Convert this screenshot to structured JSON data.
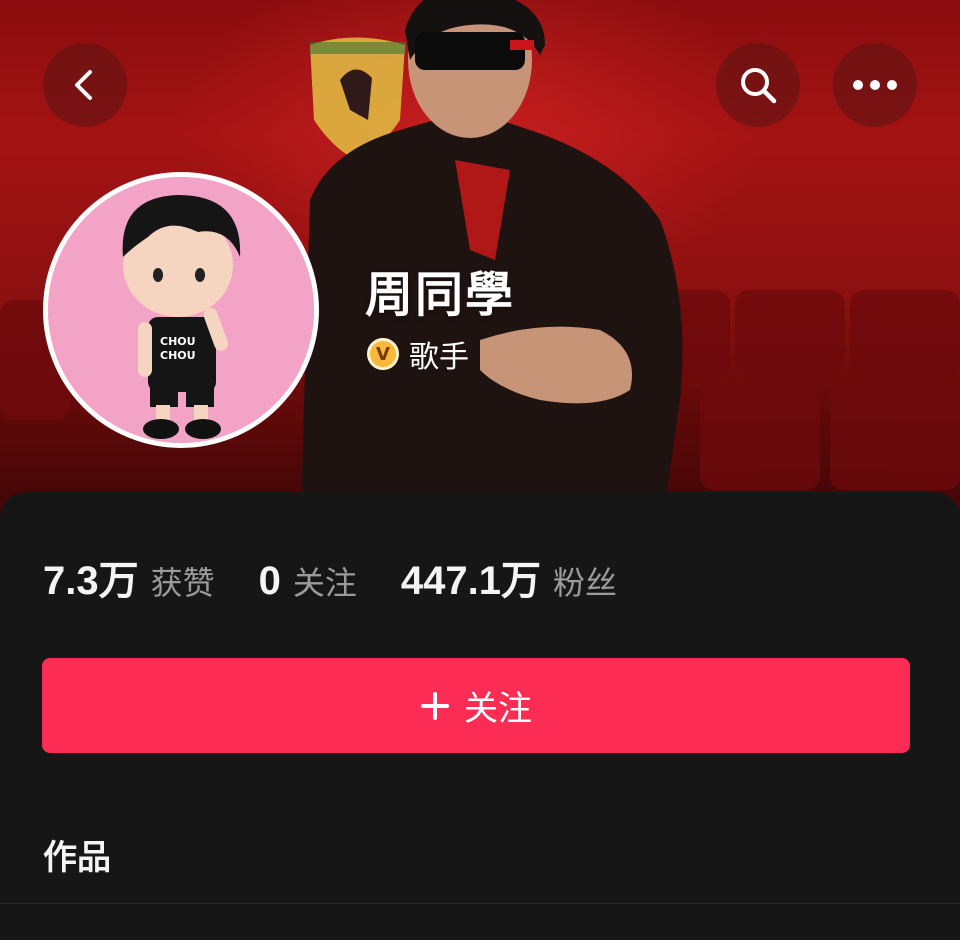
{
  "profile": {
    "name": "周同學",
    "badge_letter": "V",
    "role": "歌手"
  },
  "stats": [
    {
      "value": "7.3万",
      "label": "获赞"
    },
    {
      "value": "0",
      "label": "关注"
    },
    {
      "value": "447.1万",
      "label": "粉丝"
    }
  ],
  "follow_button": {
    "label": "关注"
  },
  "sections": {
    "works_title": "作品"
  },
  "icons": {
    "back": "chevron-left-icon",
    "search": "search-icon",
    "more": "more-horizontal-icon",
    "plus": "plus-icon"
  },
  "colors": {
    "accent": "#fd2c55",
    "badge": "#f6b93b",
    "panel_bg": "#161616",
    "banner_red": "#a41313"
  }
}
